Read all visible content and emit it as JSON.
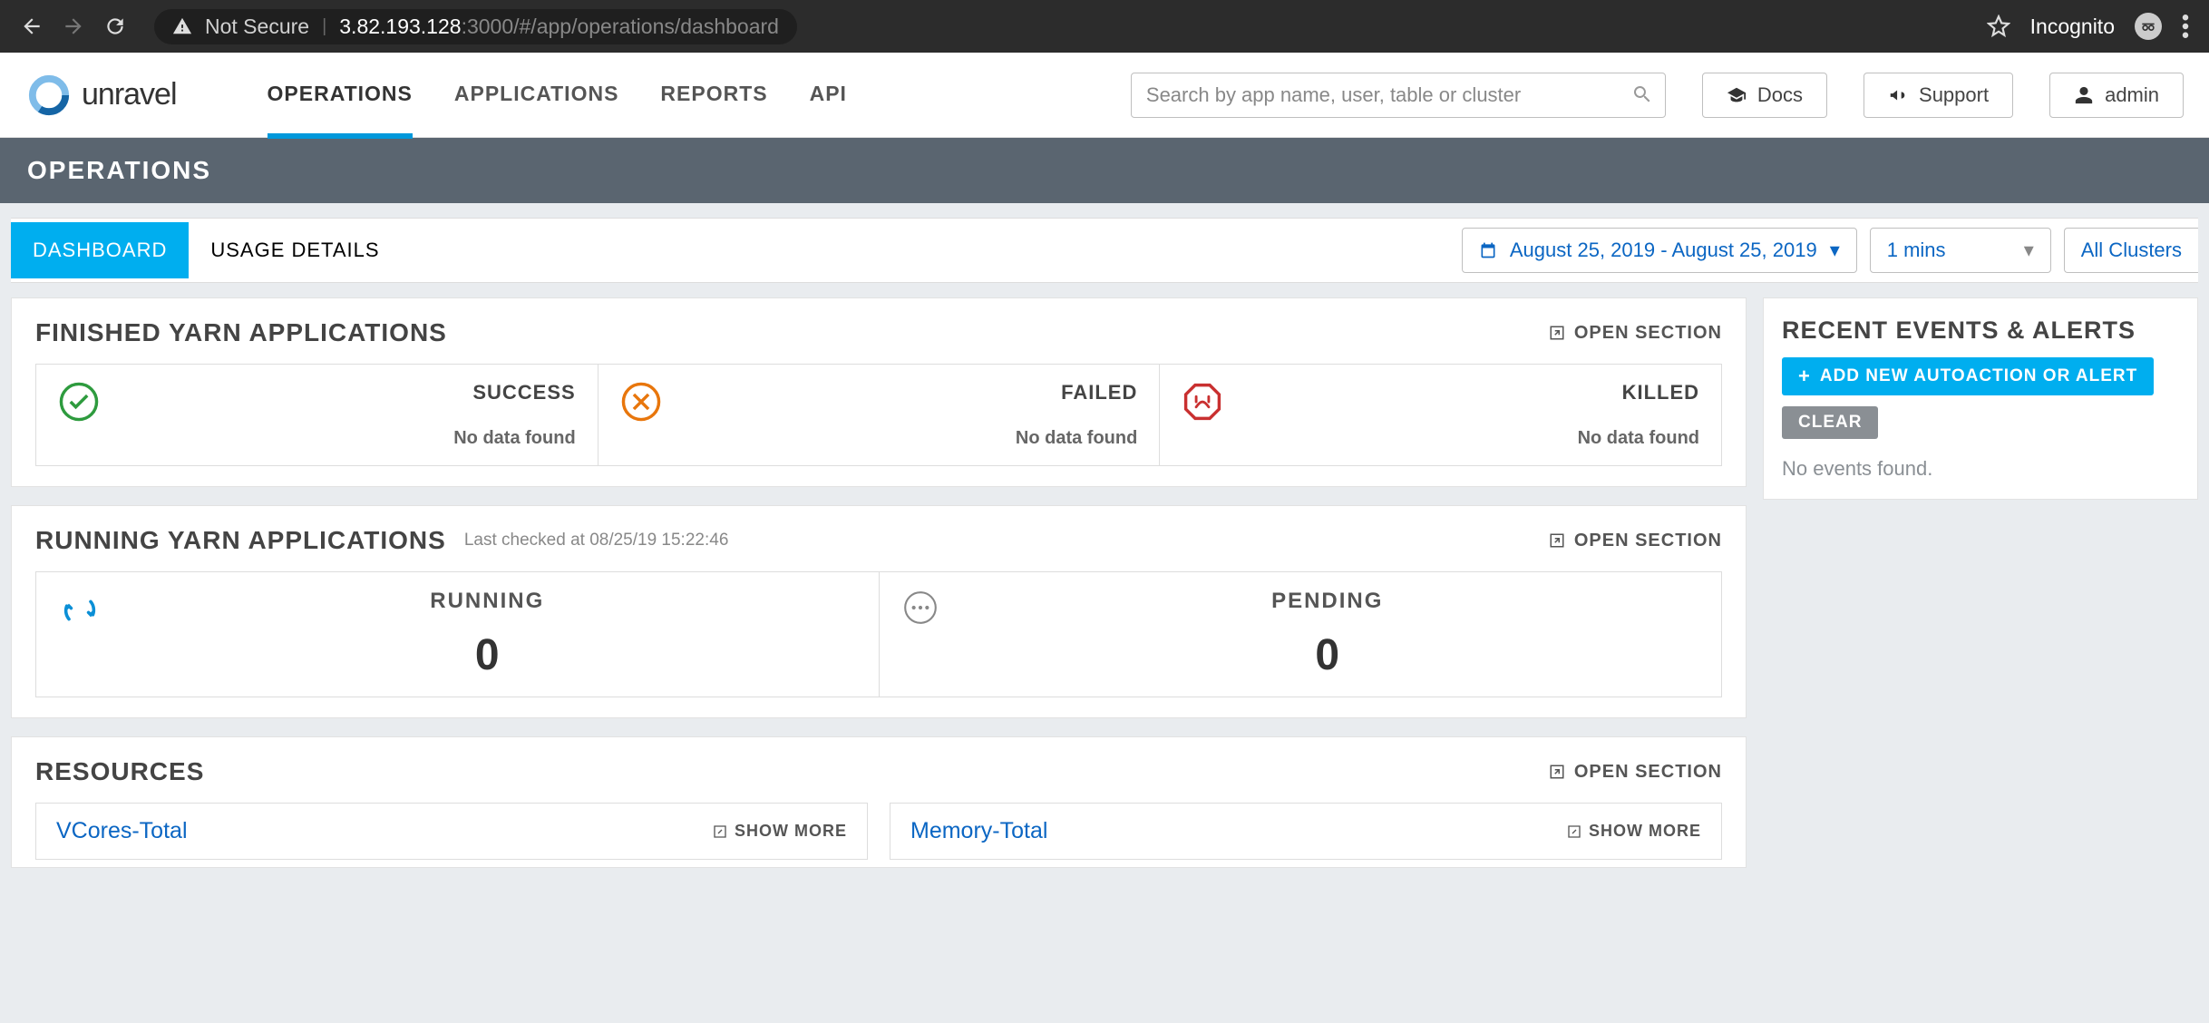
{
  "browser": {
    "not_secure": "Not Secure",
    "url_host": "3.82.193.128",
    "url_rest": ":3000/#/app/operations/dashboard",
    "incognito": "Incognito"
  },
  "header": {
    "brand": "unravel",
    "nav": [
      "OPERATIONS",
      "APPLICATIONS",
      "REPORTS",
      "API"
    ],
    "search_placeholder": "Search by app name, user, table or cluster",
    "docs": "Docs",
    "support": "Support",
    "user": "admin"
  },
  "page": {
    "title": "OPERATIONS",
    "tabs": [
      "DASHBOARD",
      "USAGE DETAILS"
    ],
    "date_range": "August 25, 2019 - August 25, 2019",
    "interval": "1 mins",
    "cluster": "All Clusters"
  },
  "finished": {
    "title": "FINISHED YARN APPLICATIONS",
    "open": "OPEN SECTION",
    "cells": [
      {
        "label": "SUCCESS",
        "msg": "No data found"
      },
      {
        "label": "FAILED",
        "msg": "No data found"
      },
      {
        "label": "KILLED",
        "msg": "No data found"
      }
    ]
  },
  "running": {
    "title": "RUNNING YARN APPLICATIONS",
    "subtitle": "Last checked at 08/25/19 15:22:46",
    "open": "OPEN SECTION",
    "cells": [
      {
        "label": "RUNNING",
        "value": "0"
      },
      {
        "label": "PENDING",
        "value": "0"
      }
    ]
  },
  "resources": {
    "title": "RESOURCES",
    "open": "OPEN SECTION",
    "cells": [
      {
        "title": "VCores-Total",
        "more": "SHOW MORE"
      },
      {
        "title": "Memory-Total",
        "more": "SHOW MORE"
      }
    ]
  },
  "events": {
    "title": "RECENT EVENTS & ALERTS",
    "add": "ADD NEW AUTOACTION OR ALERT",
    "clear": "CLEAR",
    "empty": "No events found."
  }
}
